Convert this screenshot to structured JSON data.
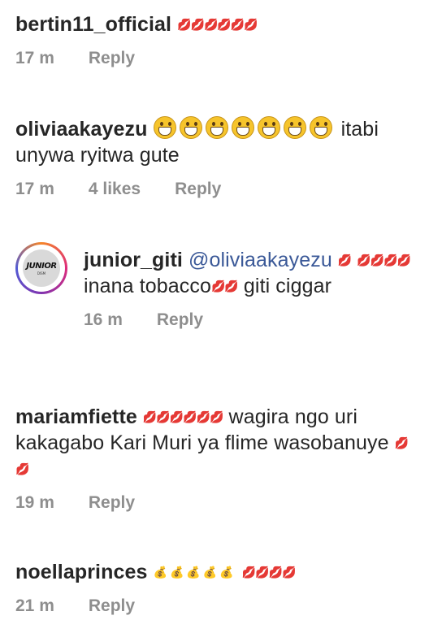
{
  "comments": [
    {
      "username": "bertin11_official",
      "text": "",
      "emoji_after_name": "💋💋💋💋💋💋",
      "time": "17 m",
      "likes": "",
      "reply_label": "Reply"
    },
    {
      "username": "oliviaakayezu",
      "grin_emoji_count": 7,
      "text": " itabi unywa ryitwa gute",
      "time": "17 m",
      "likes": "4 likes",
      "reply_label": "Reply"
    },
    {
      "username": "junior_giti",
      "mention": "@oliviaakayezu",
      "emoji_1": "💋",
      "emoji_2": "💋💋💋💋",
      "text_1": " inana tobacco",
      "emoji_3": "💋💋",
      "text_2": " giti ciggar",
      "time": "16 m",
      "reply_label": "Reply",
      "avatar": {
        "logo_text": "JUNIOR",
        "logo_sub": "DISM"
      }
    },
    {
      "username": "mariamfiette",
      "emoji_1": "💋💋💋💋💋💋",
      "text_1": " wagira ngo uri kakagabo Kari Muri ya flime wasobanuye",
      "emoji_2": "💋💋",
      "time": "19 m",
      "reply_label": "Reply"
    },
    {
      "username": "noellaprinces",
      "emoji_orange": "💰💰💰💰💰",
      "emoji_pink": "💋💋💋💋",
      "time": "21 m",
      "reply_label": "Reply"
    }
  ],
  "colors": {
    "text": "#262626",
    "meta": "#8e8e8e",
    "mention": "#3b5998",
    "lips": "#ec4fa0"
  }
}
